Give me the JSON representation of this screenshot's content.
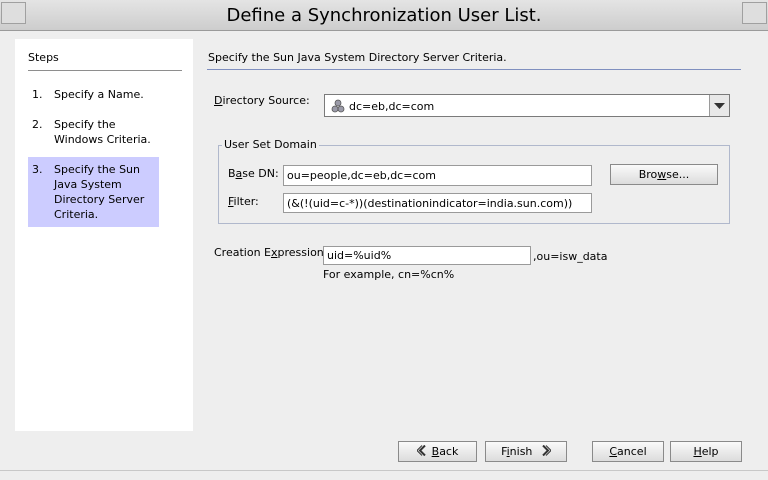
{
  "window": {
    "title": "Define a Synchronization User List."
  },
  "steps": {
    "title": "Steps",
    "items": [
      {
        "num": "1.",
        "label": "Specify a Name."
      },
      {
        "num": "2.",
        "label": "Specify the Windows Criteria."
      },
      {
        "num": "3.",
        "label": "Specify the Sun Java System Directory Server Criteria."
      }
    ]
  },
  "main": {
    "heading": "Specify the Sun Java System Directory Server Criteria.",
    "directory_source": {
      "label": "Directory Source:",
      "mnemonic": "D",
      "value": "dc=eb,dc=com"
    },
    "user_set_domain": {
      "legend": "User Set Domain",
      "base_dn": {
        "label": "Base DN:",
        "value": "ou=people,dc=eb,dc=com"
      },
      "filter": {
        "label": "Filter:",
        "value": "(&(!(uid=c-*))(destinationindicator=india.sun.com))"
      },
      "browse_label": "Browse..."
    },
    "creation_expression": {
      "label": "Creation Expression:",
      "value": "uid=%uid%",
      "suffix": ",ou=isw_data",
      "example": "For example, cn=%cn%"
    }
  },
  "footer": {
    "back": "Back",
    "finish": "Finish",
    "cancel": "Cancel",
    "help": "Help"
  }
}
